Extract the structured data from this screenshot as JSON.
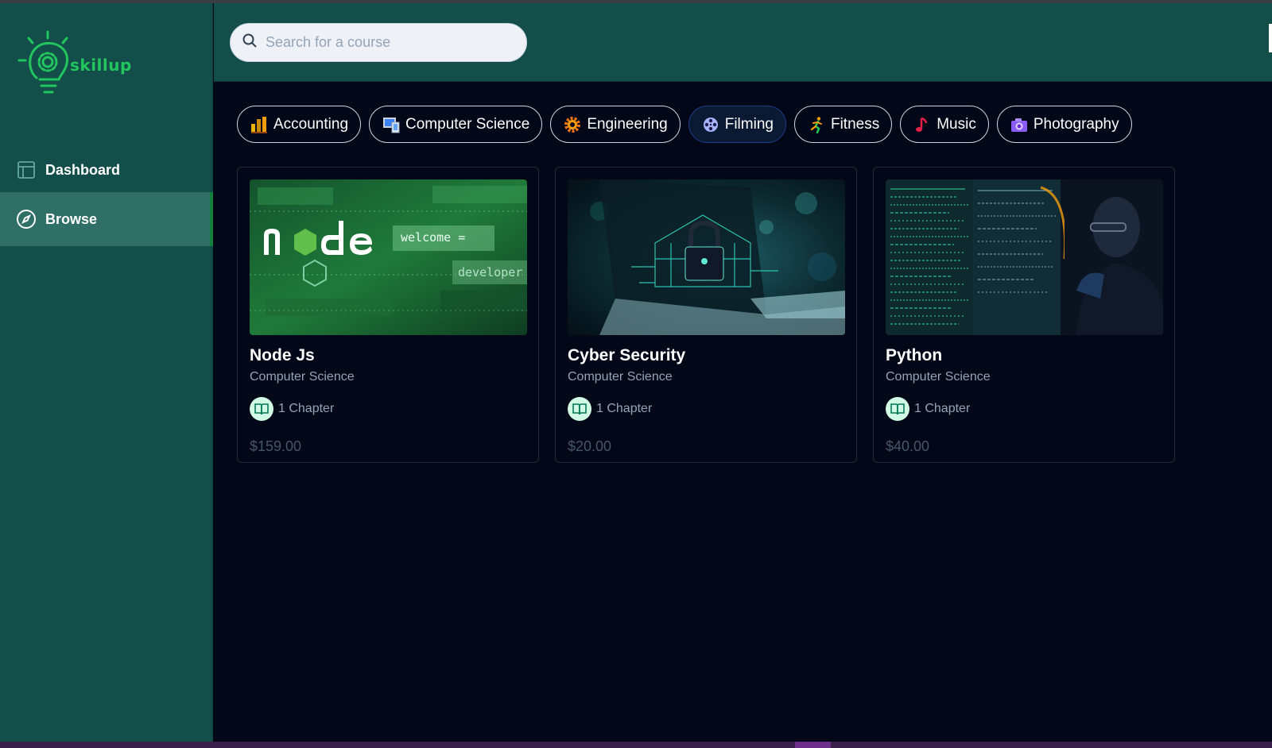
{
  "app": {
    "logo_text": "skillup",
    "logo_color": "#22c55e"
  },
  "sidebar": {
    "items": [
      {
        "label": "Dashboard",
        "icon": "layout-icon",
        "active": false
      },
      {
        "label": "Browse",
        "icon": "compass-icon",
        "active": true
      }
    ]
  },
  "search": {
    "placeholder": "Search for a course",
    "value": ""
  },
  "categories": [
    {
      "label": "Accounting",
      "icon": "bar-chart-emoji-icon"
    },
    {
      "label": "Computer Science",
      "icon": "computer-emoji-icon"
    },
    {
      "label": "Engineering",
      "icon": "gear-emoji-icon"
    },
    {
      "label": "Filming",
      "icon": "film-reel-emoji-icon",
      "selected": true
    },
    {
      "label": "Fitness",
      "icon": "runner-emoji-icon"
    },
    {
      "label": "Music",
      "icon": "music-note-emoji-icon"
    },
    {
      "label": "Photography",
      "icon": "camera-emoji-icon"
    }
  ],
  "courses": [
    {
      "title": "Node Js",
      "category": "Computer Science",
      "chapters": "1 Chapter",
      "price": "$159.00",
      "thumb_text": [
        "welcome =",
        "developer"
      ]
    },
    {
      "title": "Cyber Security",
      "category": "Computer Science",
      "chapters": "1 Chapter",
      "price": "$20.00"
    },
    {
      "title": "Python",
      "category": "Computer Science",
      "chapters": "1 Chapter",
      "price": "$40.00"
    }
  ],
  "colors": {
    "sidebar_bg": "#134e4a",
    "active_nav_bg": "#2f6f66",
    "main_bg": "#020817",
    "accent": "#15803d"
  }
}
